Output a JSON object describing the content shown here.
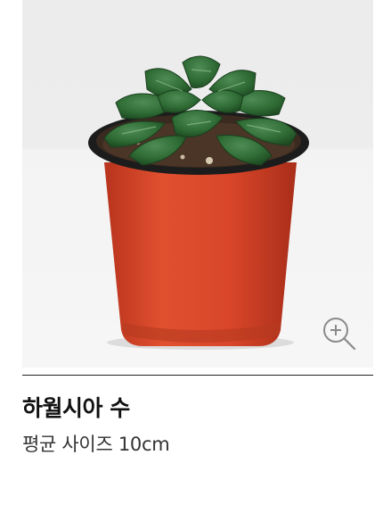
{
  "product": {
    "name": "하월시아 수",
    "size_text": "평균 사이즈 10cm"
  },
  "icons": {
    "zoom": "zoom-in-icon"
  },
  "colors": {
    "pot": "#d9462a",
    "leaf": "#2f6b34",
    "divider": "#222222",
    "title_text": "#111111",
    "subtitle_text": "#333333"
  }
}
